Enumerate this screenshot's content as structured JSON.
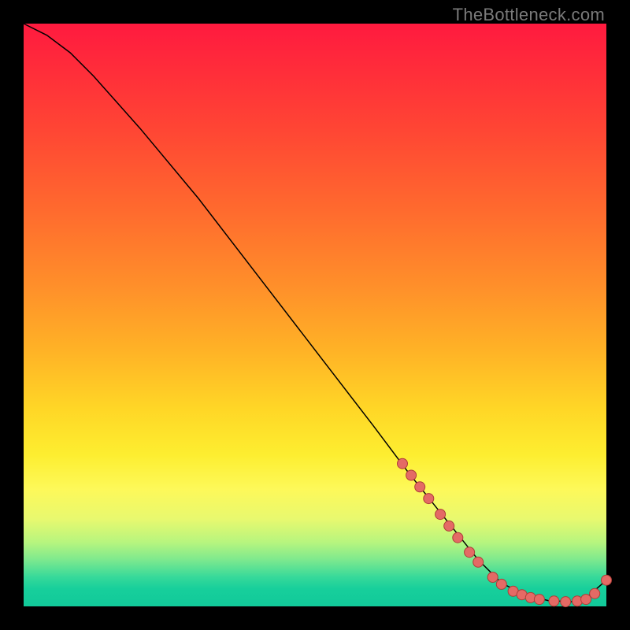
{
  "watermark": "TheBottleneck.com",
  "colors": {
    "dot_fill": "#e46a65",
    "dot_stroke": "#ae3d38",
    "curve": "#000000",
    "frame_bg": "#000000"
  },
  "chart_data": {
    "type": "line",
    "title": "",
    "xlabel": "",
    "ylabel": "",
    "xlim": [
      0,
      100
    ],
    "ylim": [
      0,
      100
    ],
    "series": [
      {
        "name": "bottleneck-curve",
        "x": [
          0,
          4,
          8,
          12,
          20,
          30,
          40,
          50,
          60,
          66,
          70,
          74,
          78,
          82,
          86,
          90,
          94,
          96,
          100
        ],
        "y": [
          100,
          98,
          95,
          91,
          82,
          70,
          57,
          44,
          31,
          23,
          18,
          13,
          8,
          4,
          2,
          1,
          0.8,
          1.0,
          4.5
        ]
      }
    ],
    "markers": {
      "name": "highlight-dots",
      "points": [
        {
          "x": 65.0,
          "y": 24.5
        },
        {
          "x": 66.5,
          "y": 22.5
        },
        {
          "x": 68.0,
          "y": 20.5
        },
        {
          "x": 69.5,
          "y": 18.5
        },
        {
          "x": 71.5,
          "y": 15.8
        },
        {
          "x": 73.0,
          "y": 13.8
        },
        {
          "x": 74.5,
          "y": 11.8
        },
        {
          "x": 76.5,
          "y": 9.3
        },
        {
          "x": 78.0,
          "y": 7.6
        },
        {
          "x": 80.5,
          "y": 5.0
        },
        {
          "x": 82.0,
          "y": 3.8
        },
        {
          "x": 84.0,
          "y": 2.6
        },
        {
          "x": 85.5,
          "y": 2.0
        },
        {
          "x": 87.0,
          "y": 1.5
        },
        {
          "x": 88.5,
          "y": 1.2
        },
        {
          "x": 91.0,
          "y": 0.9
        },
        {
          "x": 93.0,
          "y": 0.8
        },
        {
          "x": 95.0,
          "y": 0.9
        },
        {
          "x": 96.5,
          "y": 1.2
        },
        {
          "x": 98.0,
          "y": 2.2
        },
        {
          "x": 100.0,
          "y": 4.5
        }
      ]
    }
  }
}
